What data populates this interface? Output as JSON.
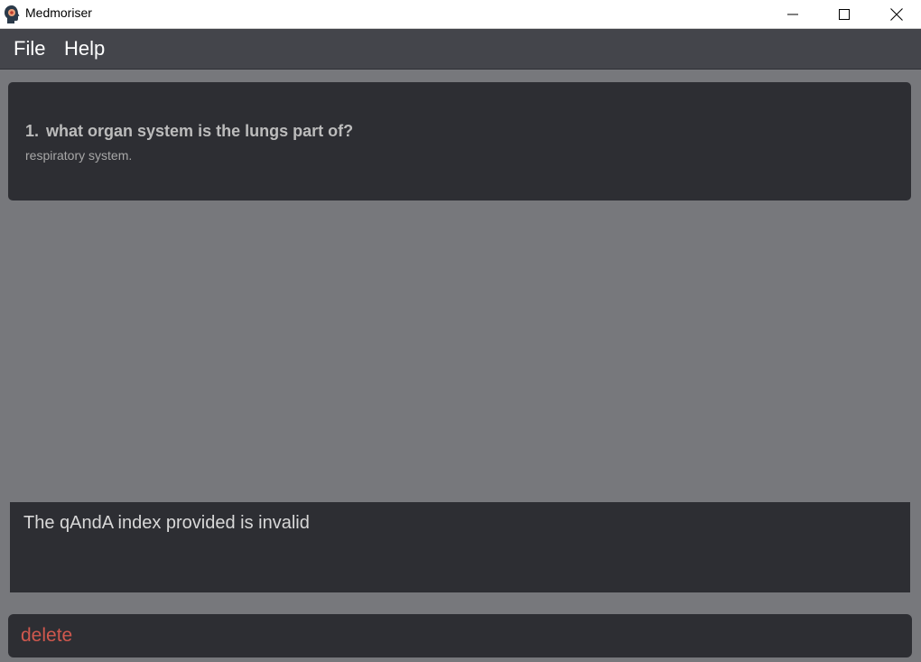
{
  "window": {
    "title": "Medmoriser",
    "app_icon": "head-silhouette-icon",
    "controls": {
      "minimize_icon": "minimize-icon",
      "maximize_icon": "maximize-icon",
      "close_icon": "close-icon"
    }
  },
  "menu": {
    "items": [
      {
        "label": "File"
      },
      {
        "label": "Help"
      }
    ]
  },
  "qanda_list": {
    "items": [
      {
        "index": "1.",
        "question": "what organ system is the lungs part of?",
        "answer": "respiratory system."
      }
    ]
  },
  "result_display": {
    "message": "The qAndA index provided is invalid"
  },
  "command_box": {
    "value": "delete",
    "error_color": "#d0584e"
  },
  "colors": {
    "background": "#77787c",
    "panel": "#2d2e33",
    "menubar": "#44454b"
  }
}
